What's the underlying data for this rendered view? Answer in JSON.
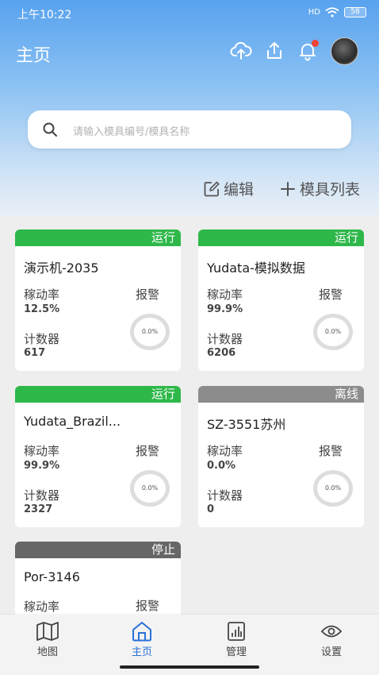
{
  "status": {
    "time": "上午10:22",
    "signal": "HD",
    "battery": "58"
  },
  "header": {
    "title": "主页"
  },
  "search": {
    "placeholder": "请输入模具编号/模具名称"
  },
  "actions": {
    "edit": "编辑",
    "mold_list": "模具列表"
  },
  "cards": [
    {
      "status": "运行",
      "status_color": "#2eb84a",
      "title": "演示机-2035",
      "rate_label": "稼动率",
      "rate": "12.5%",
      "alarm_label": "报警",
      "counter_label": "计数器",
      "counter": "617",
      "ring": "0.0%"
    },
    {
      "status": "运行",
      "status_color": "#2eb84a",
      "title": "Yudata-模拟数据",
      "rate_label": "稼动率",
      "rate": "99.9%",
      "alarm_label": "报警",
      "counter_label": "计数器",
      "counter": "6206",
      "ring": "0.0%"
    },
    {
      "status": "运行",
      "status_color": "#2eb84a",
      "title": "Yudata_Brazil...",
      "rate_label": "稼动率",
      "rate": "99.9%",
      "alarm_label": "报警",
      "counter_label": "计数器",
      "counter": "2327",
      "ring": "0.0%"
    },
    {
      "status": "离线",
      "status_color": "#8c8c8c",
      "title": "SZ-3551苏州",
      "rate_label": "稼动率",
      "rate": "0.0%",
      "alarm_label": "报警",
      "counter_label": "计数器",
      "counter": "0",
      "ring": "0.0%"
    },
    {
      "status": "停止",
      "status_color": "#666666",
      "title": "Por-3146",
      "rate_label": "稼动率",
      "alarm_label": "报警"
    }
  ],
  "tabs": [
    {
      "label": "地图",
      "icon": "map-icon"
    },
    {
      "label": "主页",
      "icon": "home-icon",
      "active": true
    },
    {
      "label": "管理",
      "icon": "chart-icon"
    },
    {
      "label": "设置",
      "icon": "settings-icon"
    }
  ],
  "accent_color": "#2a6fd6"
}
